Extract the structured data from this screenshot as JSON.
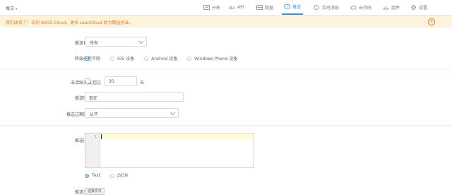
{
  "app": {
    "name": "每日"
  },
  "nav": [
    {
      "id": "analytics",
      "label": "分析",
      "icon": "analytics-icon"
    },
    {
      "id": "api",
      "label": "API",
      "icon": "api-icon"
    },
    {
      "id": "data",
      "label": "数据",
      "icon": "database-icon"
    },
    {
      "id": "push",
      "label": "推送",
      "icon": "chat-bubble-icon",
      "active": true
    },
    {
      "id": "realtime",
      "label": "实时消息",
      "icon": "message-icon"
    },
    {
      "id": "cloudcode",
      "label": "云代码",
      "icon": "cloud-icon"
    },
    {
      "id": "components",
      "label": "组件",
      "icon": "components-icon"
    },
    {
      "id": "settings",
      "label": "设置",
      "icon": "gear-icon"
    }
  ],
  "banner": {
    "text": "我们改名了！告别 AVOS Cloud，更名 LeanCloud 助力精益创业。",
    "close": "✕"
  },
  "form": {
    "target": {
      "label": "推送目标",
      "value": "所有"
    },
    "device": {
      "label": "终端类型",
      "options": [
        "不限",
        "iOS 设备",
        "Android 设备",
        "Windows Phone 设备"
      ],
      "selected": 0
    },
    "inactive": {
      "label": "未活跃天数",
      "checkbox_label": "超过",
      "days": "30",
      "unit": "天"
    },
    "time": {
      "label": "推送时间",
      "value": "现在"
    },
    "expiry": {
      "label": "推送过期时间",
      "value": "从不"
    },
    "content": {
      "label": "推送内容",
      "line_number": "1"
    },
    "format": {
      "options": [
        "Text",
        "JSON"
      ],
      "selected": 0
    },
    "file": {
      "label": "推送文件",
      "button": "选择文件"
    }
  },
  "colors": {
    "accent": "#3a8fd6",
    "banner_bg": "#fdf3dc",
    "banner_text": "#e07b1a"
  }
}
